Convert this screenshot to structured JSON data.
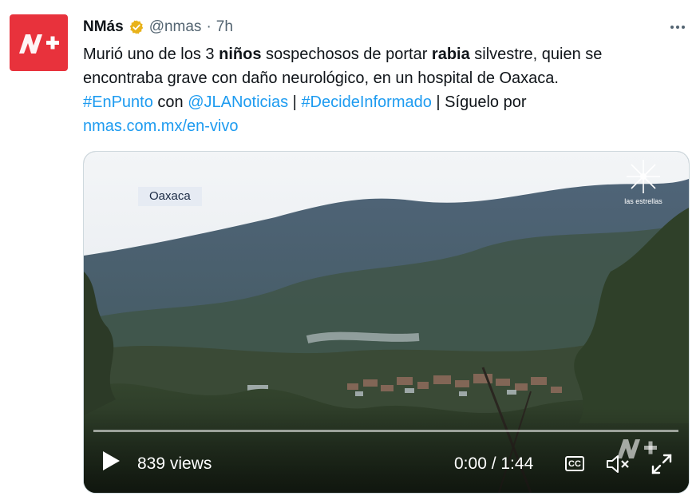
{
  "author": {
    "name": "NMás",
    "handle": "@nmas",
    "separator": "·",
    "time": "7h",
    "avatar_label": "N+",
    "avatar_color": "#e8323c",
    "verified_color": "#e8b21a"
  },
  "tweet": {
    "line1": {
      "p1": "Murió uno de los 3 ",
      "b1": "niños",
      "p2": " sospechosos de portar ",
      "b2": "rabia",
      "p3": " silvestre, quien se"
    },
    "line2": "encontraba grave con daño neurológico, en un hospital de Oaxaca.",
    "line3": {
      "tag1": "#EnPunto",
      "t1": " con ",
      "mention": "@JLANoticias",
      "t2": " | ",
      "tag2": "#DecideInformado",
      "t3": " | Síguelo por"
    },
    "link": "nmas.com.mx/en-vivo",
    "link_color": "#1d9bf0"
  },
  "video": {
    "location_tag": "Oaxaca",
    "station_caption": "las estrellas",
    "views": "839 views",
    "time": "0:00 / 1:44",
    "cc_label": "CC",
    "progress": 0
  },
  "icons": {
    "more": "more-icon",
    "verified": "verified-badge-icon",
    "play": "play-icon",
    "mute": "mute-icon",
    "fullscreen": "fullscreen-icon"
  }
}
